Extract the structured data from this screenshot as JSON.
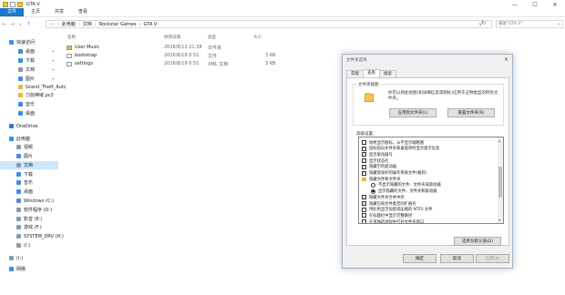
{
  "window": {
    "title": "GTA V",
    "controls": {
      "minimize": "—",
      "maximize": "☐",
      "close": "✕"
    }
  },
  "ribbon": {
    "tabs": [
      "文件",
      "主页",
      "共享",
      "查看"
    ]
  },
  "address": {
    "crumbs": [
      "此电脑",
      "文档",
      "Rockstar Games",
      "GTA V"
    ],
    "search_placeholder": "搜索\"GTA V\""
  },
  "sidebar": {
    "items": [
      {
        "label": "快速访问",
        "icon": "star-icon",
        "color": "#3a8ee6"
      },
      {
        "label": "桌面",
        "icon": "desktop-icon",
        "color": "#3a8ee6",
        "pinned": true
      },
      {
        "label": "下载",
        "icon": "download-icon",
        "color": "#3a8ee6",
        "pinned": true
      },
      {
        "label": "文档",
        "icon": "document-icon",
        "color": "#8a9bb0",
        "pinned": true
      },
      {
        "label": "图片",
        "icon": "picture-icon",
        "color": "#3a8ee6",
        "pinned": true
      },
      {
        "label": "Grand_Theft_Autc",
        "icon": "folder-icon",
        "color": "#e5b93c"
      },
      {
        "label": "刀剑神域 pc3",
        "icon": "folder-icon",
        "color": "#e5b93c"
      },
      {
        "label": "音乐",
        "icon": "music-icon",
        "color": "#3a8ee6"
      },
      {
        "label": "桌面",
        "icon": "desktop-icon",
        "color": "#3a8ee6"
      },
      {
        "label": "OneDrive",
        "icon": "cloud-icon",
        "color": "#2b78d4"
      },
      {
        "label": "此电脑",
        "icon": "computer-icon",
        "color": "#3a8ee6"
      },
      {
        "label": "视频",
        "icon": "video-icon",
        "color": "#8a9bb0"
      },
      {
        "label": "图片",
        "icon": "picture-icon",
        "color": "#3a8ee6"
      },
      {
        "label": "文档",
        "icon": "document-icon",
        "color": "#8a9bb0",
        "selected": true
      },
      {
        "label": "下载",
        "icon": "download-icon",
        "color": "#3a8ee6"
      },
      {
        "label": "音乐",
        "icon": "music-icon",
        "color": "#3a8ee6"
      },
      {
        "label": "桌面",
        "icon": "desktop-icon",
        "color": "#3a8ee6"
      },
      {
        "label": "Windows (C:)",
        "icon": "drive-icon",
        "color": "#5b8bd0"
      },
      {
        "label": "软件程序 (D:)",
        "icon": "drive-icon",
        "color": "#8a9bb0"
      },
      {
        "label": "影音 (E:)",
        "icon": "drive-icon",
        "color": "#8a9bb0"
      },
      {
        "label": "游戏 (F:)",
        "icon": "drive-icon",
        "color": "#8a9bb0"
      },
      {
        "label": "SYSTEM_DRV (H:)",
        "icon": "drive-icon",
        "color": "#8a9bb0"
      },
      {
        "label": "(I:)",
        "icon": "drive-icon",
        "color": "#8a9bb0"
      },
      {
        "label": "(I:)",
        "icon": "drive-icon",
        "color": "#8a9bb0"
      },
      {
        "label": "网络",
        "icon": "network-icon",
        "color": "#3a8ee6"
      }
    ]
  },
  "filelist": {
    "columns": [
      "名称",
      "修改日期",
      "类型",
      "大小"
    ],
    "rows": [
      {
        "name": "User Music",
        "date": "2016/8/13 21:38",
        "type": "文件夹",
        "size": "",
        "icon": "folder-icon",
        "color": "#e5b93c"
      },
      {
        "name": "bootstrap",
        "date": "2016/8/18 0:51",
        "type": "文件",
        "size": "3 KB",
        "icon": "file-icon",
        "color": "#ffffff"
      },
      {
        "name": "settings",
        "date": "2016/8/18 0:51",
        "type": "XML 文档",
        "size": "3 KB",
        "icon": "xml-file-icon",
        "color": "#ffffff"
      }
    ]
  },
  "dialog": {
    "title": "文件夹选项",
    "close": "✕",
    "tabs": [
      "常规",
      "查看",
      "搜索"
    ],
    "active_tab": "查看",
    "folder_views": {
      "label": "文件夹视图",
      "text": "你可以将此视图(如详细信息或图标)应用于这种类型的所有文件夹。",
      "apply_button": "应用到文件夹(L)",
      "reset_button": "重置文件夹(R)"
    },
    "advanced_label": "高级设置:",
    "settings": [
      {
        "kind": "checkbox",
        "checked": false,
        "label": "始终显示图标，从不显示缩略图"
      },
      {
        "kind": "checkbox",
        "checked": true,
        "label": "鼠标指向文件夹和桌面项时显示提示信息"
      },
      {
        "kind": "checkbox",
        "checked": true,
        "label": "显示驱动器号"
      },
      {
        "kind": "checkbox",
        "checked": true,
        "label": "显示状态栏"
      },
      {
        "kind": "checkbox",
        "checked": true,
        "label": "隐藏空的驱动器"
      },
      {
        "kind": "checkbox",
        "checked": true,
        "label": "隐藏受保护的操作系统文件(推荐)"
      },
      {
        "kind": "folder",
        "label": "隐藏文件和文件夹"
      },
      {
        "kind": "radio",
        "checked": false,
        "label": "不显示隐藏的文件、文件夹或驱动器"
      },
      {
        "kind": "radio",
        "checked": true,
        "label": "显示隐藏的文件、文件夹和驱动器"
      },
      {
        "kind": "checkbox",
        "checked": true,
        "label": "隐藏文件夹合并冲突"
      },
      {
        "kind": "checkbox",
        "checked": true,
        "label": "隐藏已知文件类型的扩展名"
      },
      {
        "kind": "checkbox",
        "checked": false,
        "label": "用彩色显示加密或压缩的 NTFS 文件"
      },
      {
        "kind": "checkbox",
        "checked": false,
        "label": "在标题栏中显示完整路径"
      },
      {
        "kind": "checkbox",
        "checked": false,
        "label": "在单独的进程中打开文件夹窗口"
      }
    ],
    "restore_button": "还原为默认值(D)",
    "ok_button": "确定",
    "cancel_button": "取消",
    "apply_button": "应用(A)"
  }
}
